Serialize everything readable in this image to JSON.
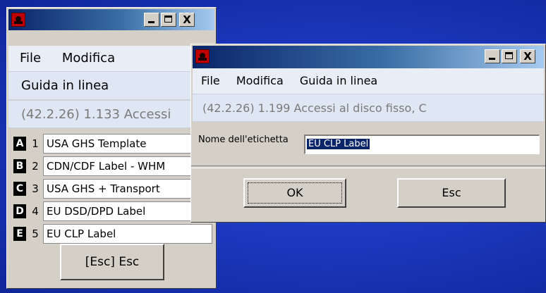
{
  "main_window": {
    "menu": {
      "file": "File",
      "edit": "Modifica",
      "help": "Guida in linea"
    },
    "status": "(42.2.26) 1.133 Accessi",
    "list": [
      {
        "letter": "A",
        "num": "1",
        "label": "USA GHS Template"
      },
      {
        "letter": "B",
        "num": "2",
        "label": "CDN/CDF Label - WHM"
      },
      {
        "letter": "C",
        "num": "3",
        "label": "USA GHS + Transport"
      },
      {
        "letter": "D",
        "num": "4",
        "label": "EU DSD/DPD Label"
      },
      {
        "letter": "E",
        "num": "5",
        "label": "EU CLP Label"
      }
    ],
    "esc_button": "[Esc] Esc"
  },
  "dialog": {
    "menu": {
      "file": "File",
      "edit": "Modifica",
      "help": "Guida in linea"
    },
    "status": "(42.2.26) 1.199 Accessi al disco fisso, C",
    "field_label": "Nome dell'etichetta",
    "field_value": "EU CLP Label",
    "ok_button": "OK",
    "esc_button": "Esc"
  },
  "titlebar_buttons": {
    "minimize": "_",
    "maximize": "□",
    "close": "X"
  },
  "colors": {
    "desktop": "#1a35b8",
    "title_active": "#0a246a",
    "selection": "#0a246a",
    "status_text": "#7a7a7a"
  }
}
